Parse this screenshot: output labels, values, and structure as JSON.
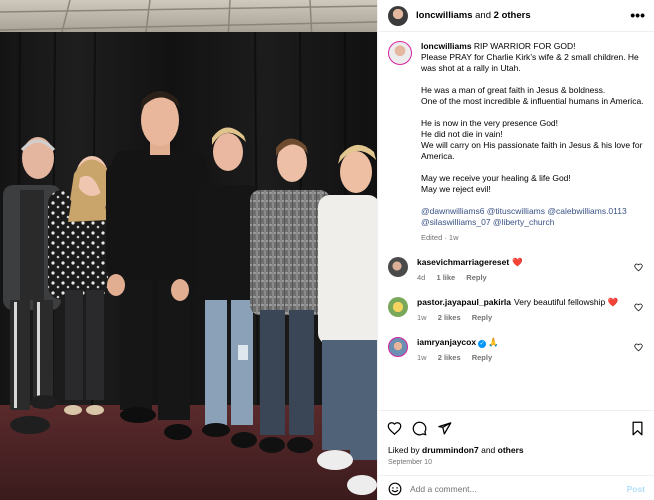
{
  "header": {
    "username": "loncwilliams",
    "joiner": "and",
    "others": "2 others",
    "more": "•••"
  },
  "caption": {
    "username": "loncwilliams",
    "lines": [
      "RIP WARRIOR FOR GOD!\nPlease PRAY for Charlie Kirk’s wife & 2 small children. He was shot at a rally in Utah.",
      "He was a man of great faith in Jesus & boldness.\nOne of the most incredible & influential humans in America.",
      "He is now in the very presence God!\nHe did not die in vain!\nWe will carry on His passionate faith in Jesus & his love for America.",
      "May we receive your healing & life God!\nMay we reject evil!"
    ],
    "tags": "@dawnwilliams6 @tituscwilliams @calebwilliams.0113 @silaswilliams_07 @liberty_church",
    "edited": "Edited · 1w"
  },
  "comments": [
    {
      "username": "kasevichmarriagereset",
      "text": "❤️",
      "time": "4d",
      "likes": "1 like",
      "reply": "Reply",
      "verified": false
    },
    {
      "username": "pastor.jayapaul_pakirla",
      "text": "Very beautiful fellowship ❤️",
      "time": "1w",
      "likes": "2 likes",
      "reply": "Reply",
      "verified": false
    },
    {
      "username": "iamryanjaycox",
      "text": "🙏",
      "time": "1w",
      "likes": "2 likes",
      "reply": "Reply",
      "verified": true
    }
  ],
  "likes": {
    "prefix": "Liked by",
    "user": "drummindon7",
    "joiner": "and",
    "others": "others"
  },
  "date": "September 10",
  "add_comment": {
    "placeholder": "Add a comment...",
    "post": "Post"
  },
  "colors": {
    "accent": "#0095f6",
    "link": "#385185",
    "muted": "#737373",
    "post_disabled": "#b2dffc",
    "like_red": "#ff3040"
  }
}
